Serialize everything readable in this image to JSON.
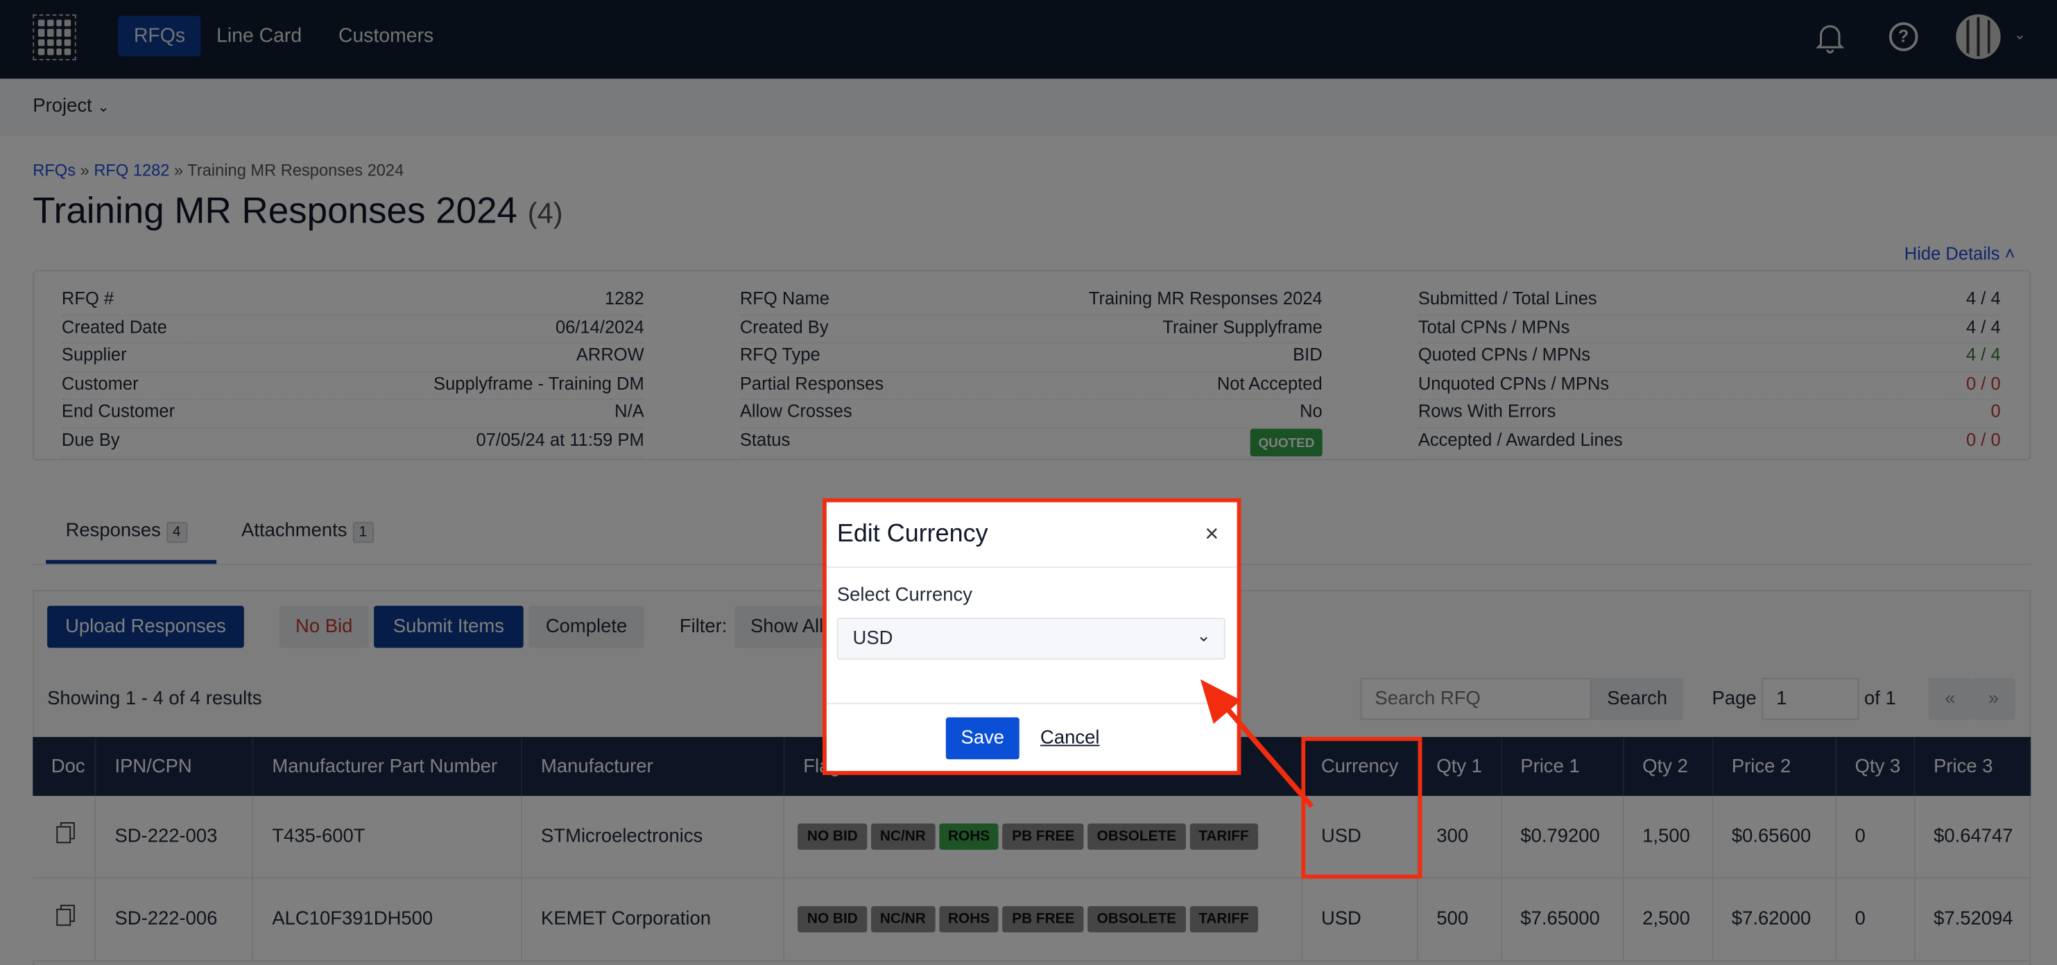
{
  "nav": {
    "items": [
      "RFQs",
      "Line Card",
      "Customers"
    ],
    "active": "RFQs",
    "icons": [
      "bell-icon",
      "help-icon",
      "avatar",
      "chevron-down-icon"
    ]
  },
  "subnav": {
    "project": "Project"
  },
  "breadcrumb": {
    "root": "RFQs",
    "rfq": "RFQ 1282",
    "current": "Training MR Responses 2024"
  },
  "page": {
    "title": "Training MR Responses 2024",
    "count": "(4)",
    "hide_details": "Hide Details"
  },
  "details": {
    "col1": [
      [
        "RFQ #",
        "1282"
      ],
      [
        "Created Date",
        "06/14/2024"
      ],
      [
        "Supplier",
        "ARROW"
      ],
      [
        "Customer",
        "Supplyframe - Training DM"
      ],
      [
        "End Customer",
        "N/A"
      ],
      [
        "Due By",
        "07/05/24 at 11:59 PM"
      ]
    ],
    "col2": [
      [
        "RFQ Name",
        "Training MR Responses 2024"
      ],
      [
        "Created By",
        "Trainer Supplyframe"
      ],
      [
        "RFQ Type",
        "BID"
      ],
      [
        "Partial Responses",
        "Not Accepted"
      ],
      [
        "Allow Crosses",
        "No"
      ],
      [
        "Status",
        "QUOTED"
      ]
    ],
    "col3": [
      [
        "Submitted / Total Lines",
        "4 / 4"
      ],
      [
        "Total CPNs / MPNs",
        "4 / 4"
      ],
      [
        "Quoted CPNs / MPNs",
        "4 / 4"
      ],
      [
        "Unquoted CPNs / MPNs",
        "0 / 0"
      ],
      [
        "Rows With Errors",
        "0"
      ],
      [
        "Accepted / Awarded Lines",
        "0 / 0"
      ]
    ]
  },
  "tabs": [
    {
      "label": "Responses",
      "count": "4"
    },
    {
      "label": "Attachments",
      "count": "1"
    }
  ],
  "toolbar": {
    "upload": "Upload Responses",
    "no_bid": "No Bid",
    "submit": "Submit Items",
    "complete": "Complete",
    "filter_label": "Filter:",
    "filter_value": "Show All"
  },
  "results": {
    "showing": "Showing 1 - 4 of 4 results",
    "search_placeholder": "Search RFQ",
    "search_btn": "Search",
    "page_label": "Page",
    "page_value": "1",
    "of": "of 1",
    "prev": "«",
    "next": "»"
  },
  "table": {
    "headers": [
      "Doc",
      "IPN/CPN",
      "Manufacturer Part Number",
      "Manufacturer",
      "Flags",
      "Currency",
      "Qty 1",
      "Price 1",
      "Qty 2",
      "Price 2",
      "Qty 3",
      "Price 3"
    ],
    "flags": [
      "NO BID",
      "NC/NR",
      "ROHS",
      "PB FREE",
      "OBSOLETE",
      "TARIFF"
    ],
    "rows": [
      {
        "ipn": "SD-222-003",
        "mpn": "T435-600T",
        "mfr": "STMicroelectronics",
        "active_flags": [
          "ROHS"
        ],
        "currency": "USD",
        "qty1": "300",
        "price1": "$0.79200",
        "qty2": "1,500",
        "price2": "$0.65600",
        "qty3": "0",
        "price3": "$0.64747"
      },
      {
        "ipn": "SD-222-006",
        "mpn": "ALC10F391DH500",
        "mfr": "KEMET Corporation",
        "active_flags": [],
        "currency": "USD",
        "qty1": "500",
        "price1": "$7.65000",
        "qty2": "2,500",
        "price2": "$7.62000",
        "qty3": "0",
        "price3": "$7.52094"
      }
    ]
  },
  "modal": {
    "title": "Edit Currency",
    "close": "×",
    "label": "Select Currency",
    "value": "USD",
    "save": "Save",
    "cancel": "Cancel"
  },
  "colors": {
    "nav": "#111c2e",
    "primary": "#0b3b91",
    "save": "#0a4fd6",
    "annotation": "#f22d0f",
    "quoted": "#35a34a",
    "error": "#c0392b",
    "ok": "#2e7d32"
  }
}
